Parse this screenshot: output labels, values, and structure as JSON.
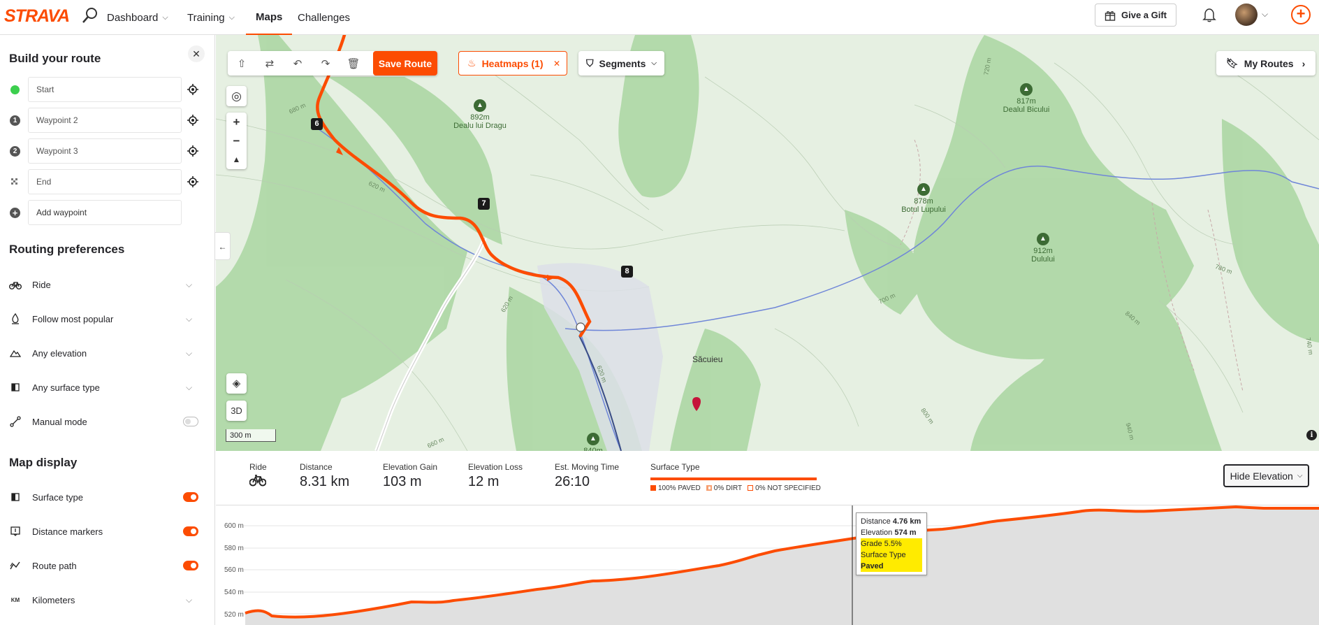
{
  "nav": {
    "logo": "STRAVA",
    "items": [
      {
        "label": "Dashboard",
        "dropdown": true
      },
      {
        "label": "Training",
        "dropdown": true
      },
      {
        "label": "Maps",
        "active": true
      },
      {
        "label": "Challenges"
      }
    ],
    "give_gift": "Give a Gift",
    "accent": "#fc4c02"
  },
  "sidebar": {
    "title": "Build your route",
    "waypoints": [
      {
        "marker": "",
        "label": "Start",
        "color": "#3ccf4e"
      },
      {
        "marker": "1",
        "label": "Waypoint 2",
        "color": "#555555"
      },
      {
        "marker": "2",
        "label": "Waypoint 3",
        "color": "#555555"
      },
      {
        "marker": "",
        "label": "End",
        "color": "#999999"
      }
    ],
    "add_waypoint": "Add waypoint",
    "routing_title": "Routing preferences",
    "routing": [
      {
        "icon": "bike-icon",
        "label": "Ride"
      },
      {
        "icon": "popular-icon",
        "label": "Follow most popular"
      },
      {
        "icon": "elevation-icon",
        "label": "Any elevation"
      },
      {
        "icon": "surface-icon",
        "label": "Any surface type"
      }
    ],
    "manual_mode": {
      "label": "Manual mode",
      "on": false
    },
    "display_title": "Map display",
    "display": [
      {
        "icon": "surface-type-icon",
        "label": "Surface type",
        "on": true
      },
      {
        "icon": "distance-markers-icon",
        "label": "Distance markers",
        "on": true
      },
      {
        "icon": "route-path-icon",
        "label": "Route path",
        "on": true
      }
    ],
    "units": {
      "icon_text": "KM",
      "label": "Kilometers"
    }
  },
  "map": {
    "toolbar": {
      "save": "Save Route"
    },
    "heatmaps": "Heatmaps (1)",
    "segments": "Segments",
    "my_routes": "My Routes",
    "three_d": "3D",
    "scale": "300 m",
    "peaks": [
      {
        "height": "892m",
        "name": "Dealu lui Dragu"
      },
      {
        "height": "817m",
        "name": "Dealul Bicului"
      },
      {
        "height": "878m",
        "name": "Botul Lupului"
      },
      {
        "height": "912m",
        "name": "Dulului"
      },
      {
        "height": "840m",
        "name": ""
      }
    ],
    "town": "Săcuieu",
    "contours": [
      "680 m",
      "620 m",
      "620 m",
      "700 m",
      "620 m",
      "800 m",
      "660 m",
      "720 m",
      "780 m",
      "840 m",
      "740 m",
      "940 m"
    ],
    "markers": [
      "6",
      "7",
      "8"
    ],
    "colors": {
      "route": "#fc4c02",
      "river": "#6f86d8",
      "forest": "#9fd09a"
    }
  },
  "stats": {
    "activity": {
      "label": "Ride"
    },
    "distance": {
      "label": "Distance",
      "value": "8.31 km"
    },
    "gain": {
      "label": "Elevation Gain",
      "value": "103 m"
    },
    "loss": {
      "label": "Elevation Loss",
      "value": "12 m"
    },
    "time": {
      "label": "Est. Moving Time",
      "value": "26:10"
    },
    "surface": {
      "label": "Surface Type",
      "legend": [
        {
          "text": "100% PAVED",
          "color": "#fc4c02"
        },
        {
          "text": "0% DIRT",
          "color": "#f7a072"
        },
        {
          "text": "0% NOT SPECIFIED",
          "color": "#ffffff"
        }
      ]
    },
    "hide_elevation": "Hide Elevation"
  },
  "elevation": {
    "y_ticks": [
      "600 m",
      "580 m",
      "560 m",
      "540 m",
      "520 m"
    ],
    "tooltip": {
      "distance_label": "Distance",
      "distance": "4.76 km",
      "elevation_label": "Elevation",
      "elevation": "574 m",
      "grade_label": "Grade",
      "grade": "5.5%",
      "surface_label": "Surface Type",
      "surface": "Paved"
    }
  }
}
